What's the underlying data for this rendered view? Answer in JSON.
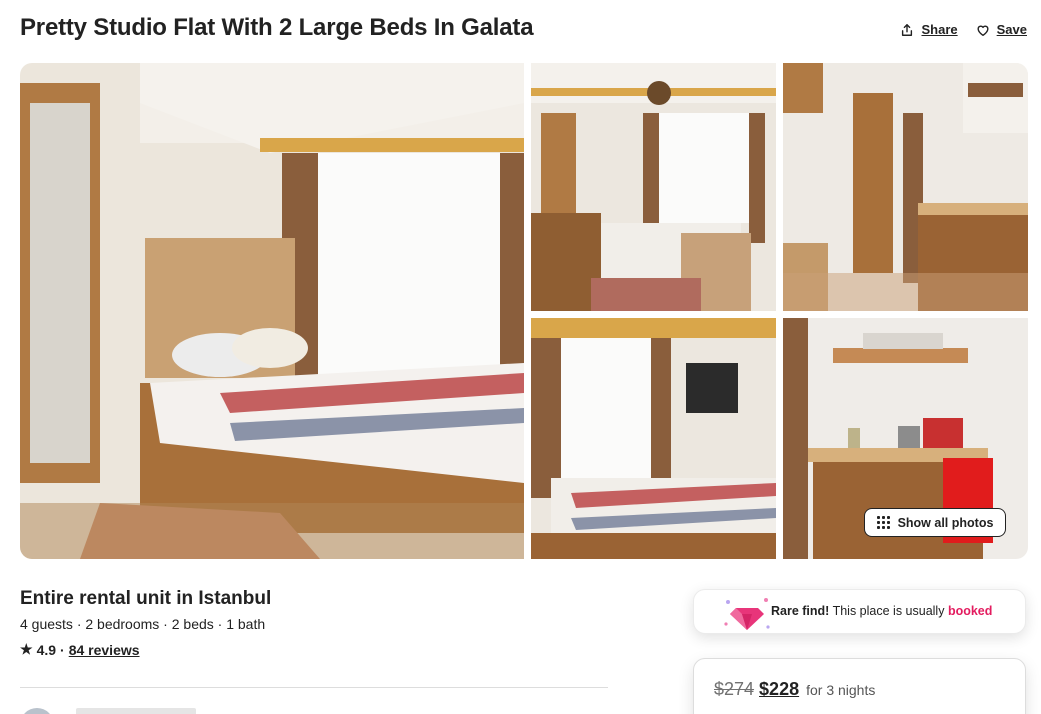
{
  "listing": {
    "title": "Pretty Studio Flat With 2 Large Beds In Galata"
  },
  "actions": {
    "share_label": "Share",
    "save_label": "Save"
  },
  "gallery": {
    "show_all_label": "Show all photos"
  },
  "overview": {
    "subtitle": "Entire rental unit in Istanbul",
    "details": "4 guests · 2 bedrooms · 2 beds · 1 bath",
    "rating": "4.9",
    "rating_separator": "·",
    "reviews_label": "84 reviews"
  },
  "rare_find": {
    "lead": "Rare find!",
    "text": "This place is usually",
    "highlight": "booked",
    "highlight_color": "#e31c5f"
  },
  "pricing": {
    "original_price": "$274",
    "discounted_price": "$228",
    "period": "for 3 nights"
  },
  "icons": {
    "share": "share-icon",
    "save": "heart-icon",
    "grid": "grid-icon",
    "star": "star-icon",
    "gem": "gem-icon"
  }
}
